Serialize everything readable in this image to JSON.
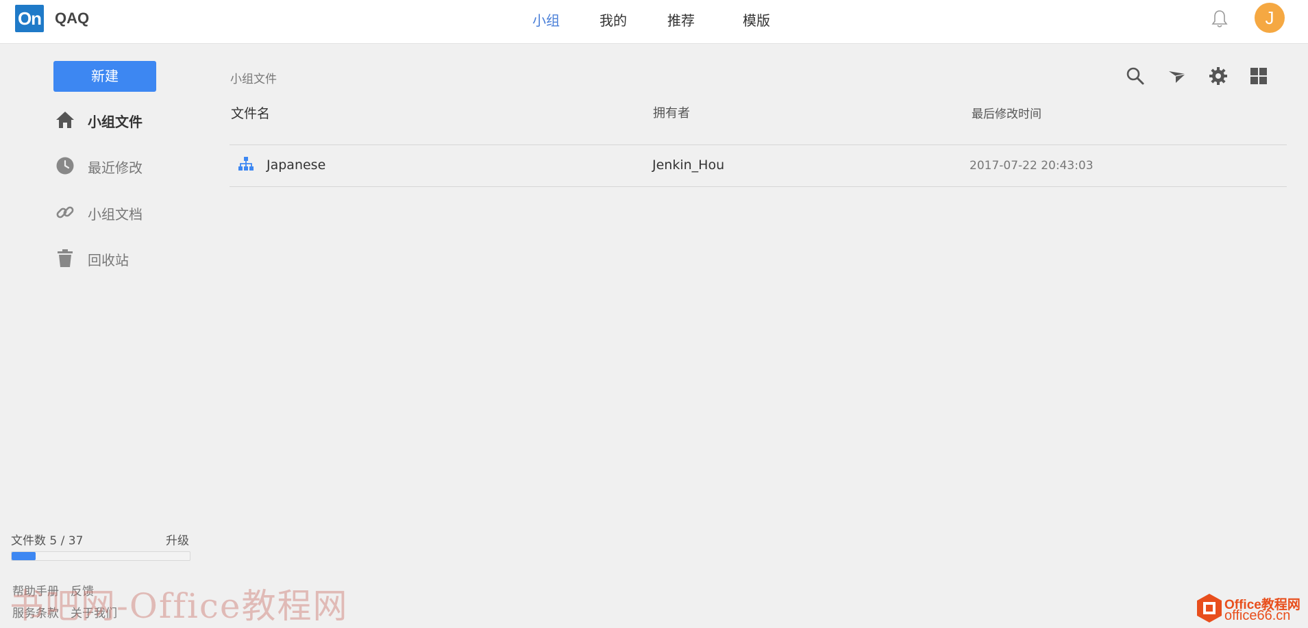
{
  "header": {
    "logo_text": "On",
    "app_name": "QAQ",
    "nav": [
      "小组",
      "我的",
      "推荐",
      "模版"
    ],
    "active_nav": "小组",
    "avatar_initial": "J",
    "icons": {
      "notifications": "bell-icon"
    }
  },
  "sidebar": {
    "new_button": "新建",
    "items": [
      {
        "label": "小组文件",
        "icon": "home-icon",
        "active": true
      },
      {
        "label": "最近修改",
        "icon": "clock-icon",
        "active": false
      },
      {
        "label": "小组文档",
        "icon": "link-icon",
        "active": false
      },
      {
        "label": "回收站",
        "icon": "trash-icon",
        "active": false
      }
    ],
    "usage": {
      "label": "文件数 5 / 37",
      "used": 5,
      "total": 37,
      "upgrade": "升级"
    },
    "footer": {
      "help": "帮助手册",
      "feedback": "反馈",
      "terms": "服务条款",
      "about": "关于我们"
    }
  },
  "main": {
    "breadcrumb": "小组文件",
    "toolbar": [
      "search-icon",
      "send-icon",
      "gear-icon",
      "grid-view-icon"
    ],
    "columns": {
      "name": "文件名",
      "owner": "拥有者",
      "modified": "最后修改时间"
    },
    "files": [
      {
        "name": "Japanese",
        "owner": "Jenkin_Hou",
        "modified": "2017-07-22 20:43:03",
        "icon": "org-chart-icon"
      }
    ]
  },
  "watermarks": {
    "left": "书吧网-Office教程网",
    "right_top": "Office教程网",
    "right_bottom": "office66.cn"
  },
  "colors": {
    "accent": "#3d87f2",
    "nav_active": "#4a7fd8",
    "avatar": "#f5a842",
    "logo": "#1f7ac8"
  }
}
